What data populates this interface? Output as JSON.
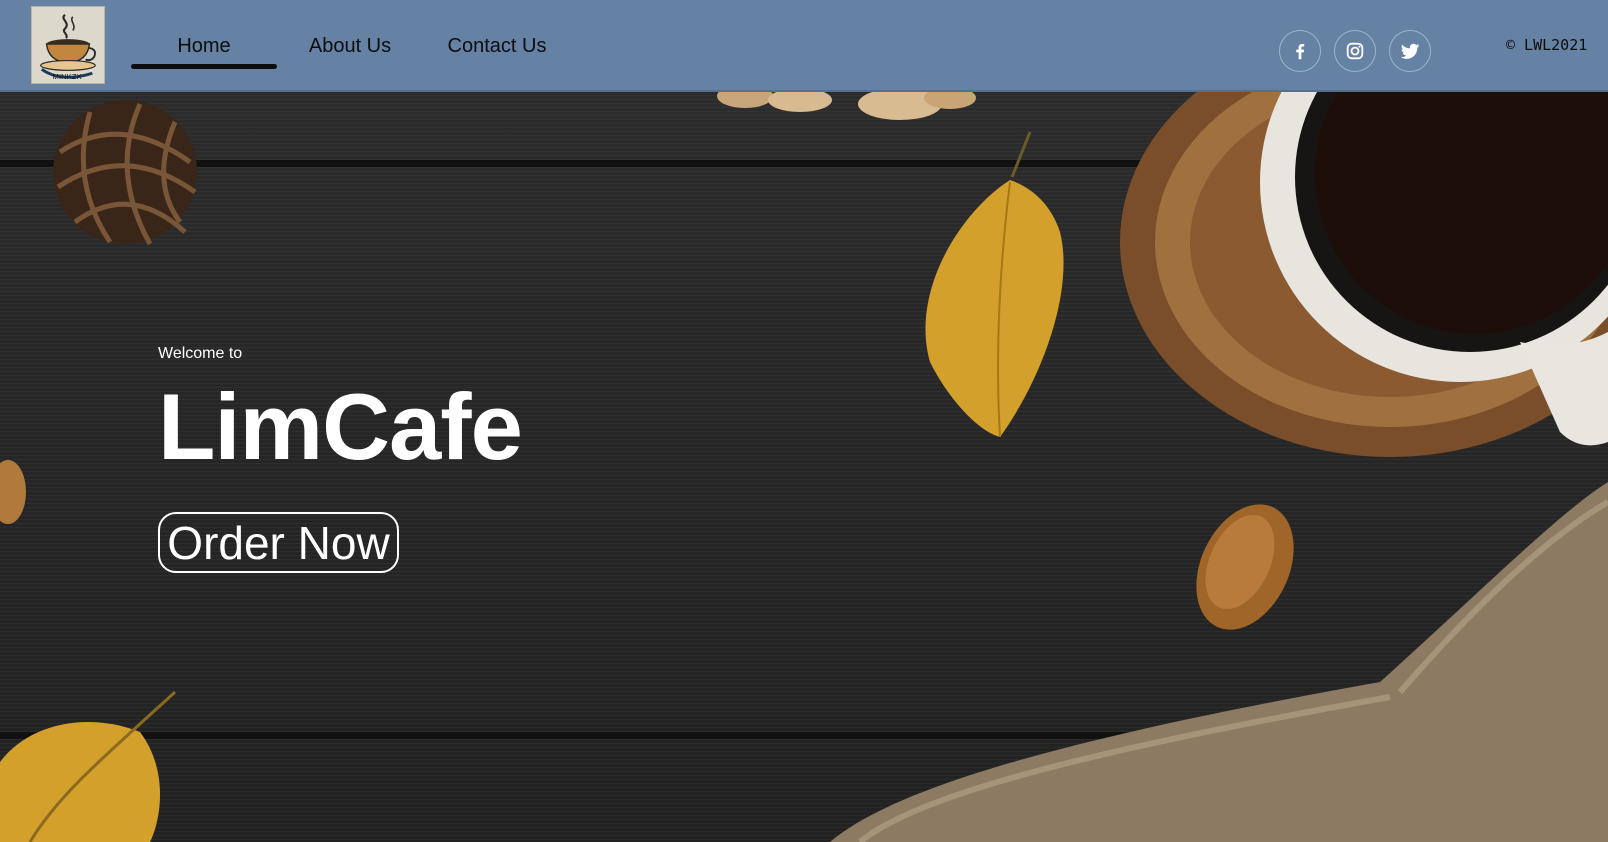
{
  "header": {
    "logo_text": "MINKZX",
    "nav": [
      {
        "label": "Home",
        "active": true
      },
      {
        "label": "About Us",
        "active": false
      },
      {
        "label": "Contact Us",
        "active": false
      }
    ],
    "social": [
      {
        "icon": "facebook-icon"
      },
      {
        "icon": "instagram-icon"
      },
      {
        "icon": "twitter-icon"
      }
    ],
    "copyright": "© LWL2021"
  },
  "hero": {
    "welcome": "Welcome to",
    "brand": "LimCafe",
    "cta_label": "Order Now"
  },
  "colors": {
    "navbar": "#6581a4",
    "text_dark": "#0d0d0d",
    "hero_text": "#ffffff",
    "leaf": "#d4a02c",
    "wood": "#262626"
  }
}
